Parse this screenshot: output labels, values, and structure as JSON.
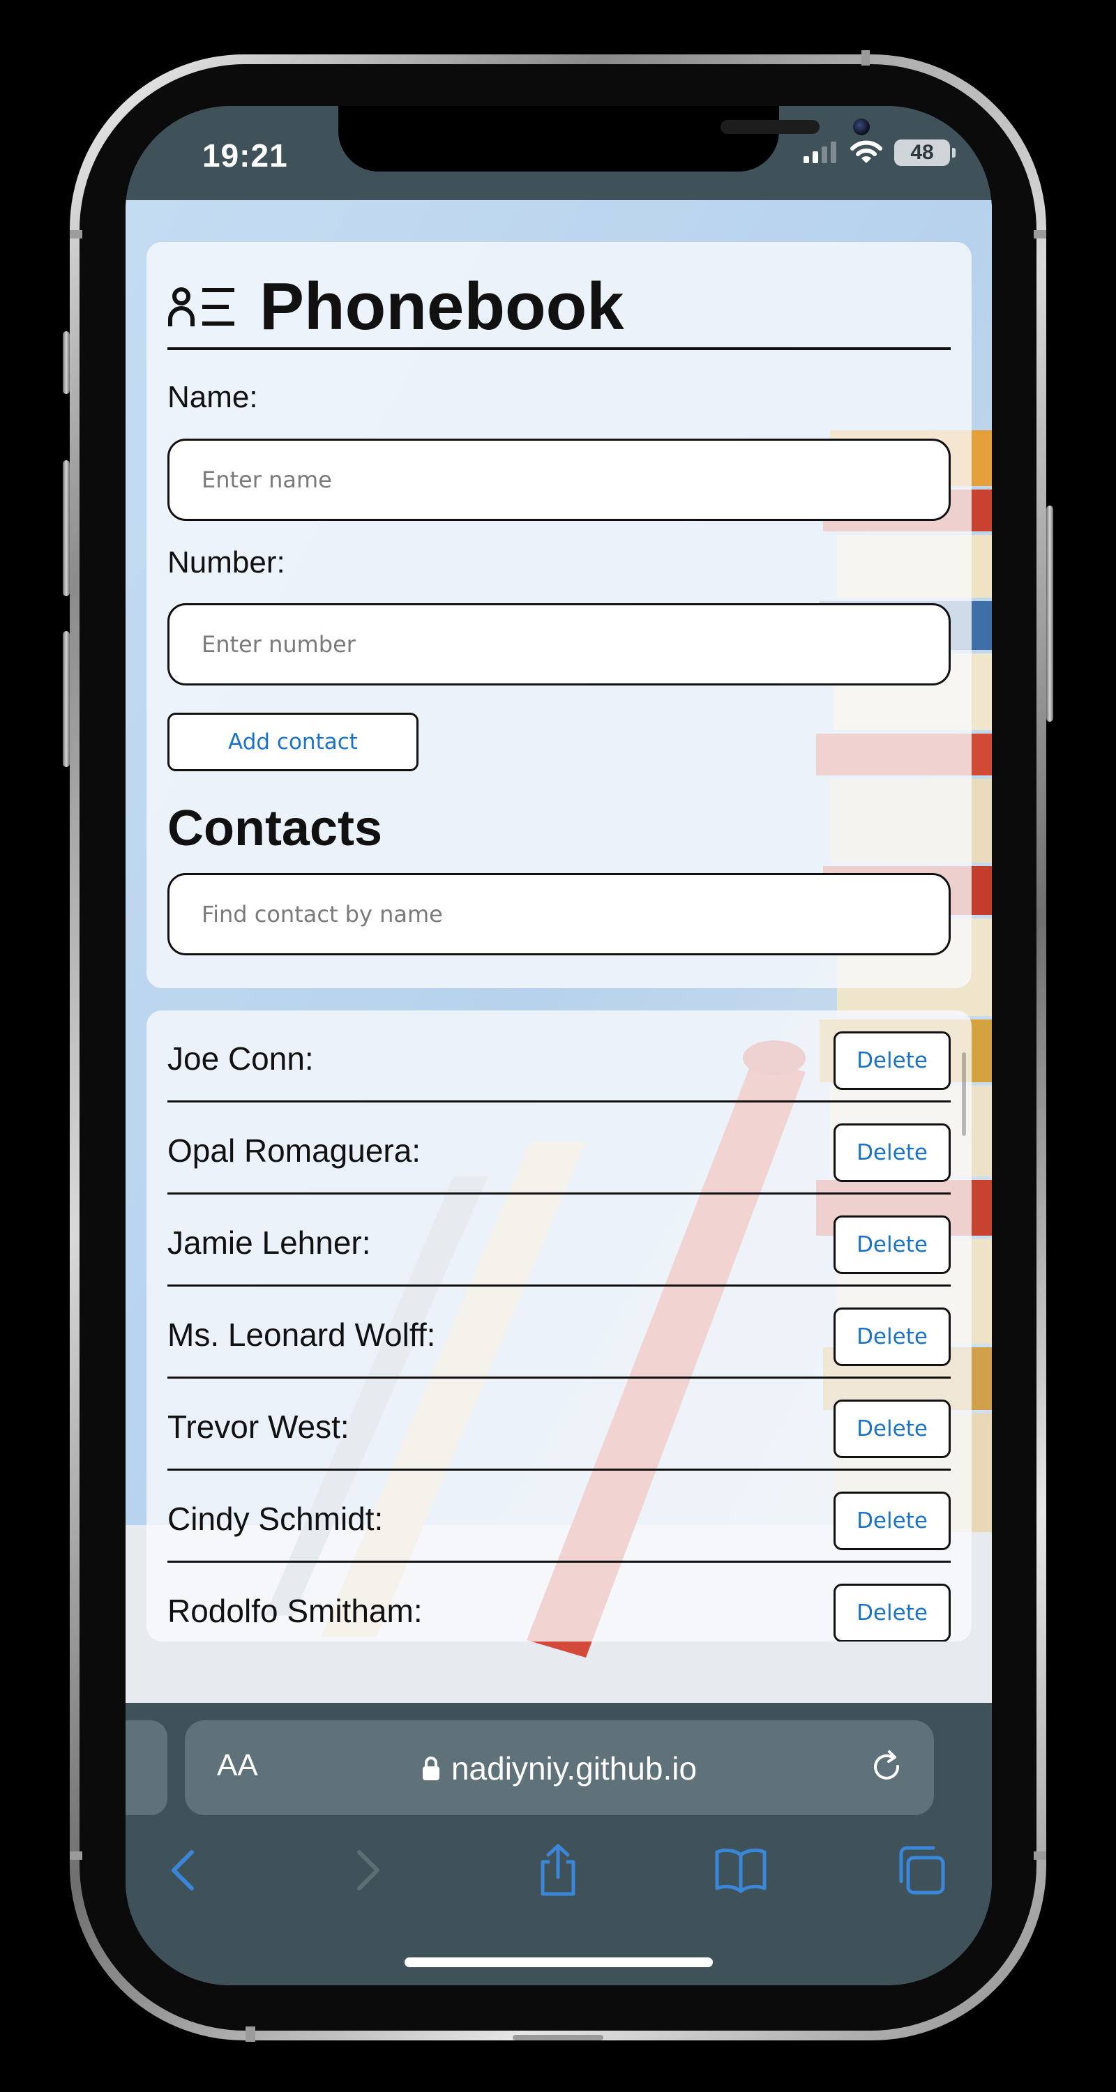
{
  "status_bar": {
    "time": "19:21",
    "battery": "48"
  },
  "app": {
    "title": "Phonebook",
    "name_label": "Name:",
    "name_placeholder": "Enter name",
    "number_label": "Number:",
    "number_placeholder": "Enter number",
    "add_button": "Add contact",
    "contacts_title": "Contacts",
    "filter_placeholder": "Find contact by name",
    "delete_label": "Delete"
  },
  "contacts": [
    {
      "name": "Joe Conn:"
    },
    {
      "name": "Opal Romaguera:"
    },
    {
      "name": "Jamie Lehner:"
    },
    {
      "name": "Ms. Leonard Wolff:"
    },
    {
      "name": "Trevor West:"
    },
    {
      "name": "Cindy Schmidt:"
    },
    {
      "name": "Rodolfo Smitham:"
    }
  ],
  "browser": {
    "text_size_label": "AA",
    "url": "nadiyniy.github.io"
  },
  "colors": {
    "accent": "#1a73c8",
    "chrome": "#405259",
    "address_bar": "#5f7279",
    "toolbar_icon": "#3a86d8"
  }
}
